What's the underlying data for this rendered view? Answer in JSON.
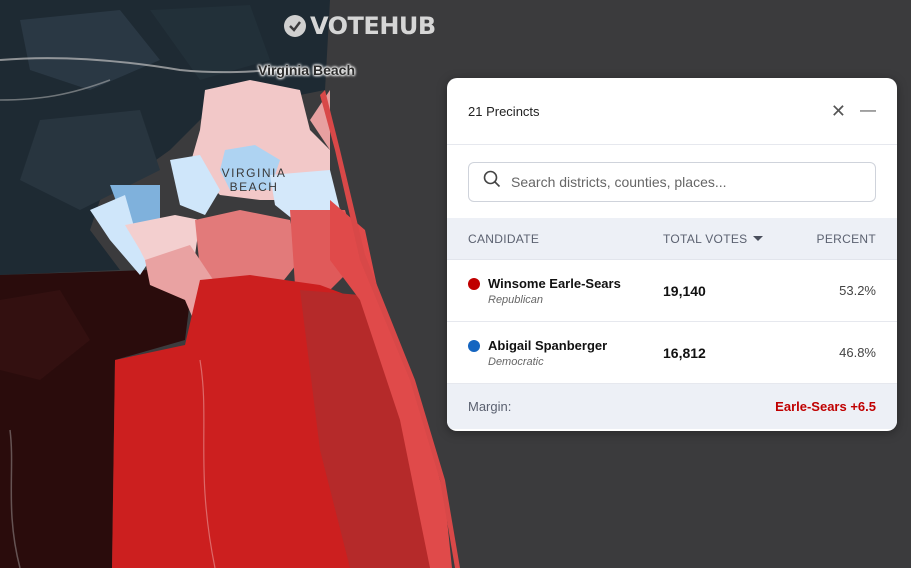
{
  "brand": {
    "name": "VOTEHUB",
    "icon": "check-circle-icon"
  },
  "map": {
    "city_label": "Virginia Beach",
    "area_label_line1": "VIRGINIA",
    "area_label_line2": "BEACH"
  },
  "panel": {
    "title": "21 Precincts",
    "search": {
      "placeholder": "Search districts, counties, places...",
      "value": ""
    },
    "columns": {
      "candidate": "CANDIDATE",
      "votes": "TOTAL VOTES",
      "percent": "PERCENT"
    },
    "candidates": [
      {
        "name": "Winsome Earle-Sears",
        "party": "Republican",
        "votes": "19,140",
        "percent": "53.2%",
        "color": "#c00000"
      },
      {
        "name": "Abigail Spanberger",
        "party": "Democratic",
        "votes": "16,812",
        "percent": "46.8%",
        "color": "#1565c0"
      }
    ],
    "margin": {
      "label": "Margin:",
      "value": "Earle-Sears +6.5",
      "color": "#c00000"
    }
  }
}
